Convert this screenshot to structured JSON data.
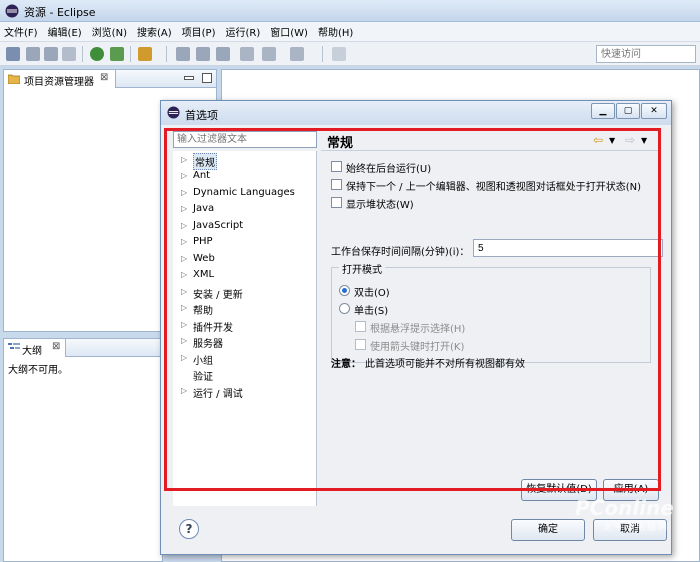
{
  "window": {
    "title": "资源 - Eclipse"
  },
  "menu": [
    "文件(F)",
    "编辑(E)",
    "浏览(N)",
    "搜索(A)",
    "项目(P)",
    "运行(R)",
    "窗口(W)",
    "帮助(H)"
  ],
  "quick_access": {
    "placeholder": "快速访问"
  },
  "project_explorer": {
    "title": "项目资源管理器"
  },
  "outline": {
    "title": "大纲",
    "message": "大纲不可用。"
  },
  "dialog": {
    "title": "首选项",
    "filter_placeholder": "输入过滤器文本",
    "tree": [
      {
        "label": "常规",
        "expandable": true,
        "selected": true
      },
      {
        "label": "Ant",
        "expandable": true
      },
      {
        "label": "Dynamic Languages",
        "expandable": true
      },
      {
        "label": "Java",
        "expandable": true
      },
      {
        "label": "JavaScript",
        "expandable": true
      },
      {
        "label": "PHP",
        "expandable": true
      },
      {
        "label": "Web",
        "expandable": true
      },
      {
        "label": "XML",
        "expandable": true
      },
      {
        "label": "安装 / 更新",
        "expandable": true
      },
      {
        "label": "帮助",
        "expandable": true
      },
      {
        "label": "插件开发",
        "expandable": true
      },
      {
        "label": "服务器",
        "expandable": true
      },
      {
        "label": "小组",
        "expandable": true
      },
      {
        "label": "验证",
        "expandable": false
      },
      {
        "label": "运行 / 调试",
        "expandable": true
      }
    ],
    "page": {
      "title": "常规",
      "options": [
        {
          "label": "始终在后台运行(U)",
          "checked": false
        },
        {
          "label": "保持下一个 / 上一个编辑器、视图和透视图对话框处于打开状态(N)",
          "checked": false
        },
        {
          "label": "显示堆状态(W)",
          "checked": false
        }
      ],
      "interval_label": "工作台保存时间间隔(分钟)(i)：",
      "interval_value": "5",
      "open_mode": {
        "title": "打开模式",
        "double_click": "双击(O)",
        "single_click": "单击(S)",
        "hover_select": "根据悬浮提示选择(H)",
        "arrow_open": "使用箭头键时打开(K)",
        "selected": "double_click"
      },
      "note_label": "注意：",
      "note_text": "此首选项可能并不对所有视图都有效",
      "restore_defaults": "恢复默认值(D)",
      "apply": "应用(A)"
    },
    "ok": "确定",
    "cancel": "取消"
  },
  "watermark": {
    "text": "PConline",
    "sub": "太平洋电脑网"
  },
  "colors": {
    "highlight": "#e31b23",
    "accent": "#2a6dd0"
  }
}
